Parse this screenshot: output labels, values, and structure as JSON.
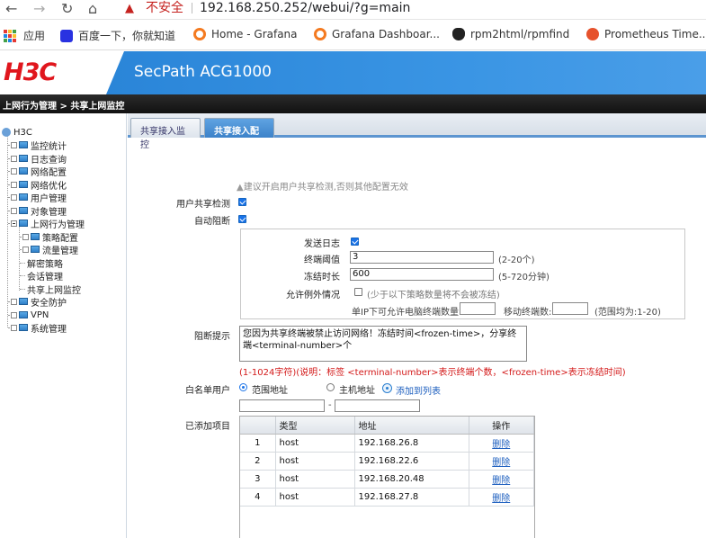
{
  "browser": {
    "insecure_label": "不安全",
    "url": "192.168.250.252/webui/?g=main",
    "bookmarks": [
      "应用",
      "百度一下，你就知道",
      "Home - Grafana",
      "Grafana Dashboar...",
      "rpm2html/rpmfind",
      "Prometheus Time..."
    ]
  },
  "header": {
    "logo": "H3C",
    "product": "SecPath ACG1000"
  },
  "breadcrumb": "上网行为管理 > 共享上网监控",
  "sidebar": {
    "root": "H3C",
    "items": [
      "监控统计",
      "日志查询",
      "网络配置",
      "网络优化",
      "用户管理",
      "对象管理",
      "上网行为管理",
      "策略配置",
      "流量管理",
      "解密策略",
      "会话管理",
      "共享上网监控",
      "安全防护",
      "VPN",
      "系统管理"
    ]
  },
  "tabs": [
    "共享接入监控",
    "共享接入配置"
  ],
  "form": {
    "note": "建议开启用户共享检测,否则其他配置无效",
    "share_detect_label": "用户共享检测",
    "share_detect_checked": true,
    "auto_block_label": "自动阻断",
    "auto_block_checked": true,
    "send_log_label": "发送日志",
    "send_log_checked": true,
    "terminal_threshold_label": "终端阈值",
    "terminal_threshold_value": "3",
    "terminal_threshold_hint": "(2-20个)",
    "freeze_time_label": "冻结时长",
    "freeze_time_value": "600",
    "freeze_time_hint": "(5-720分钟)",
    "allow_exception_label": "允许例外情况",
    "allow_exception_checked": false,
    "allow_exception_hint": "(少于以下策略数量将不会被冻结)",
    "single_ip_label": "单IP下可允许电脑终端数量:",
    "mobile_label": "移动终端数:",
    "range_hint": "(范围均为:1-20)",
    "block_prompt_label": "阻断提示",
    "block_prompt_text": "您因为共享终端被禁止访问网络！冻结时间<frozen-time>，分享终端<terminal-number>个",
    "block_prompt_help": "(1-1024字符)(说明：标签 <terminal-number>表示终端个数，<frozen-time>表示冻结时间)",
    "whitelist_label": "白名单用户",
    "range_addr_label": "范围地址",
    "host_addr_label": "主机地址",
    "add_to_list_label": "添加到列表",
    "range_dash": "-",
    "added_label": "已添加项目"
  },
  "table": {
    "columns": [
      "",
      "类型",
      "地址",
      "操作"
    ],
    "rows": [
      {
        "idx": "1",
        "type": "host",
        "addr": "192.168.26.8",
        "op": "删除"
      },
      {
        "idx": "2",
        "type": "host",
        "addr": "192.168.22.6",
        "op": "删除"
      },
      {
        "idx": "3",
        "type": "host",
        "addr": "192.168.20.48",
        "op": "删除"
      },
      {
        "idx": "4",
        "type": "host",
        "addr": "192.168.27.8",
        "op": "删除"
      }
    ]
  },
  "colors": {
    "brand_red": "#e0161d",
    "header_blue": "#3a95e4",
    "tab_active": "#3c82c9",
    "help_red": "#d31818",
    "link_blue": "#1d5fbf"
  }
}
